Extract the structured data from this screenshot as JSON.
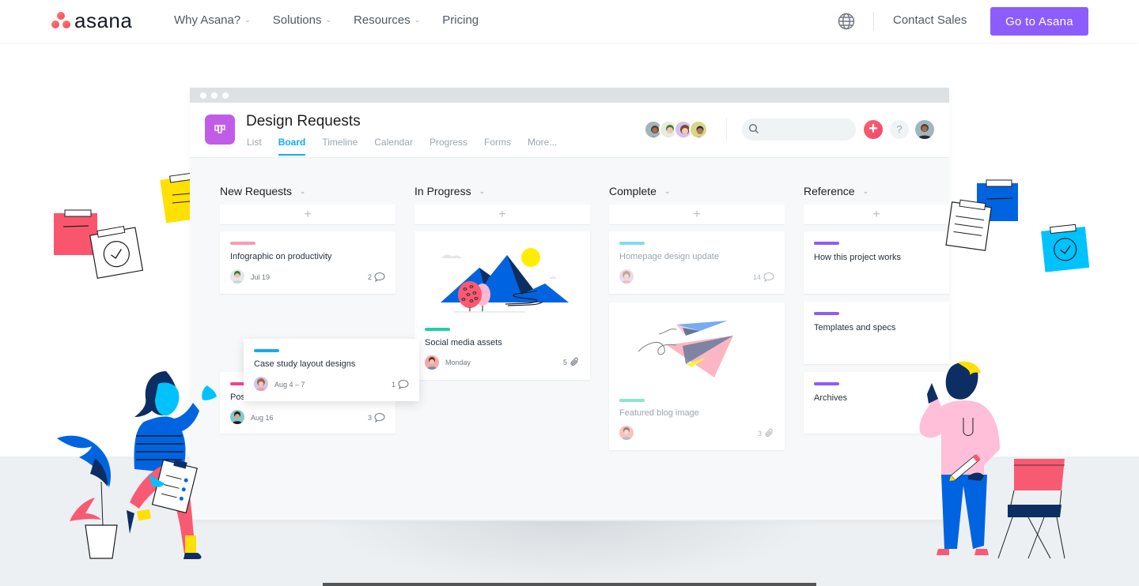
{
  "nav": {
    "brand": "asana",
    "links": [
      {
        "label": "Why Asana?",
        "has_dropdown": true
      },
      {
        "label": "Solutions",
        "has_dropdown": true
      },
      {
        "label": "Resources",
        "has_dropdown": true
      },
      {
        "label": "Pricing",
        "has_dropdown": false
      }
    ],
    "language_icon": "globe-icon",
    "contact_label": "Contact Sales",
    "cta_label": "Go to Asana",
    "cta_color": "#8d5cfd"
  },
  "app": {
    "project_title": "Design Requests",
    "project_color": "#c15ce9",
    "tabs": [
      {
        "label": "List",
        "active": false
      },
      {
        "label": "Board",
        "active": true
      },
      {
        "label": "Timeline",
        "active": false
      },
      {
        "label": "Calendar",
        "active": false
      },
      {
        "label": "Progress",
        "active": false
      },
      {
        "label": "Forms",
        "active": false
      },
      {
        "label": "More...",
        "active": false
      }
    ],
    "add_label": "+",
    "help_label": "?",
    "search_placeholder": ""
  },
  "board": {
    "columns": [
      {
        "title": "New Requests",
        "add_label": "+",
        "cards": [
          {
            "name": "Infographic on productivity",
            "tag_color": "#f99ab0",
            "date": "Jul 19",
            "count": "2",
            "count_icon": "comment-icon"
          },
          {
            "name": "Pos",
            "tag_color": "#f0468c",
            "date": "Aug 16",
            "count": "3",
            "count_icon": "comment-icon"
          }
        ]
      },
      {
        "title": "In Progress",
        "add_label": "+",
        "cards": [
          {
            "name": "Social media assets",
            "tag_color": "#1fd1a7",
            "date": "Monday",
            "count": "5",
            "count_icon": "attachment-icon"
          }
        ]
      },
      {
        "title": "Complete",
        "add_label": "+",
        "cards": [
          {
            "name": "Homepage design update",
            "tag_color": "#82d9f6",
            "date": "",
            "count": "14",
            "count_icon": "comment-icon"
          },
          {
            "name": "Featured blog image",
            "tag_color": "#8ee5cf",
            "date": "",
            "count": "3",
            "count_icon": "attachment-icon"
          }
        ]
      },
      {
        "title": "Reference",
        "add_label": "+",
        "cards": [
          {
            "name": "How this project works",
            "tag_color": "#8d5cfd"
          },
          {
            "name": "Templates and specs",
            "tag_color": "#8d5cfd"
          },
          {
            "name": "Archives",
            "tag_color": "#8d5cfd"
          }
        ]
      }
    ],
    "dragging_card": {
      "name": "Case study layout designs",
      "tag_color": "#14aaf5",
      "date": "Aug 4 – 7",
      "count": "1",
      "count_icon": "comment-icon"
    }
  }
}
